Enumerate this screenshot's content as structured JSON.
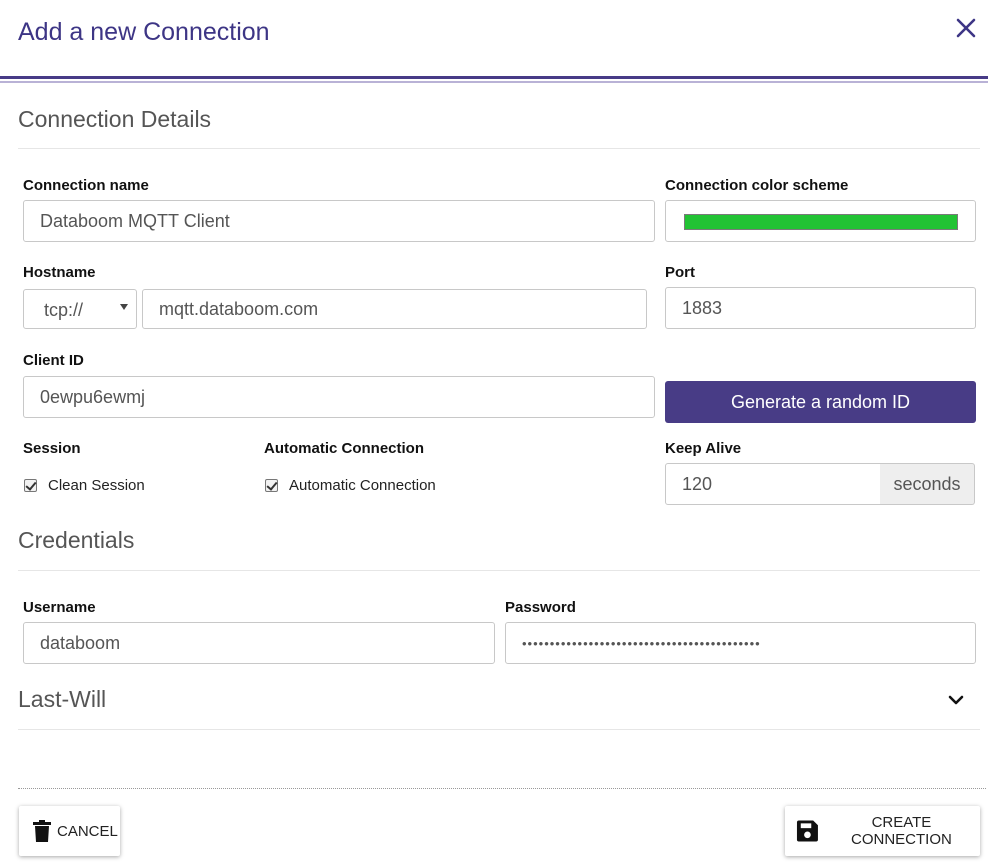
{
  "dialog": {
    "title": "Add a new Connection",
    "close_icon": "close-icon",
    "accent_color": "#473b87"
  },
  "connection_details": {
    "section_title": "Connection Details",
    "connection_name": {
      "label": "Connection name",
      "value": "Databoom MQTT Client"
    },
    "color_scheme": {
      "label": "Connection color scheme",
      "color": "#22c334"
    },
    "hostname": {
      "label": "Hostname",
      "protocol": "tcp://",
      "value": "mqtt.databoom.com"
    },
    "port": {
      "label": "Port",
      "value": "1883"
    },
    "client_id": {
      "label": "Client ID",
      "value": "0ewpu6ewmj"
    },
    "generate_button": "Generate a random ID",
    "session": {
      "label": "Session",
      "checkbox_label": "Clean Session",
      "checked": true
    },
    "automatic_connection": {
      "label": "Automatic Connection",
      "checkbox_label": "Automatic Connection",
      "checked": true
    },
    "keep_alive": {
      "label": "Keep Alive",
      "value": "120",
      "unit": "seconds"
    }
  },
  "credentials": {
    "section_title": "Credentials",
    "username": {
      "label": "Username",
      "value": "databoom"
    },
    "password": {
      "label": "Password",
      "value": "•••••••••••••••••••••••••••••••••••••••••••"
    }
  },
  "last_will": {
    "section_title": "Last-Will",
    "expand_icon": "chevron-down-icon"
  },
  "footer": {
    "cancel_label": "CANCEL",
    "cancel_icon": "trash-icon",
    "create_label": "CREATE CONNECTION",
    "create_icon": "save-icon"
  }
}
